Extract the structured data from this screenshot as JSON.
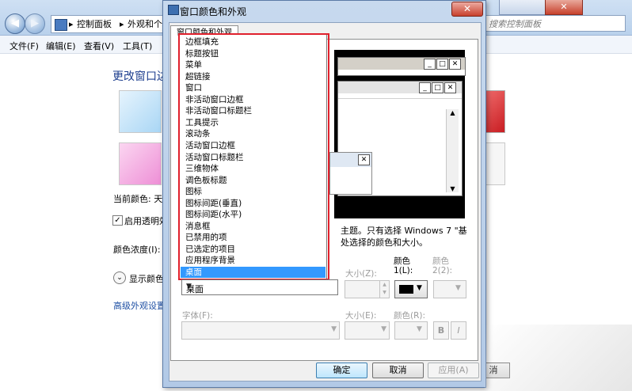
{
  "explorer": {
    "back_glyph": "◀",
    "forward_glyph": "▶",
    "breadcrumb": [
      "控制面板",
      "外观和个"
    ],
    "breadcrumb_sep": "▸",
    "search_placeholder": "搜索控制面板",
    "close_glyph": "✕",
    "menu": [
      "文件(F)",
      "编辑(E)",
      "查看(V)",
      "工具(T)"
    ],
    "heading": "更改窗口边",
    "current_color_label": "当前颜色: 天",
    "enable_transparency_label": "启用透明效",
    "color_intensity_label": "颜色浓度(I):",
    "show_mixer_label": "显示颜色",
    "advanced_link": "高级外观设置",
    "cancel_partial": "消",
    "swatch_colors": {
      "sky": "#bfe0f7",
      "pink": "#f2a4dc",
      "red": "#d7262a"
    }
  },
  "dialog": {
    "title": "窗口颜色和外观",
    "close_glyph": "✕",
    "tab_label": "窗口颜色和外观",
    "preview": {
      "win1_buttons": [
        "_",
        "□",
        "✕"
      ],
      "win2_buttons": [
        "_",
        "□",
        "✕"
      ],
      "msg_close": "✕"
    },
    "description_line1": "主题。只有选择 Windows 7 \"基",
    "description_line2": "处选择的颜色和大小。",
    "items": [
      "边框填充",
      "标题按钮",
      "菜单",
      "超链接",
      "窗口",
      "非活动窗口边框",
      "非活动窗口标题栏",
      "工具提示",
      "滚动条",
      "活动窗口边框",
      "活动窗口标题栏",
      "三维物体",
      "调色板标题",
      "图标",
      "图标间距(垂直)",
      "图标间距(水平)",
      "消息框",
      "已禁用的项",
      "已选定的项目",
      "应用程序背景",
      "桌面"
    ],
    "selected_item": "桌面",
    "combo_value": "桌面",
    "size_label": "大小(Z):",
    "color1_label": "颜色",
    "color1_sub": "1(L):",
    "color2_label": "颜色",
    "color2_sub": "2(2):",
    "font_label": "字体(F):",
    "font_size_label": "大小(E):",
    "font_color_label": "颜色(R):",
    "bold_label": "B",
    "italic_label": "I",
    "ok_label": "确定",
    "cancel_label": "取消",
    "apply_label": "应用(A)",
    "color1_value": "#000000"
  }
}
